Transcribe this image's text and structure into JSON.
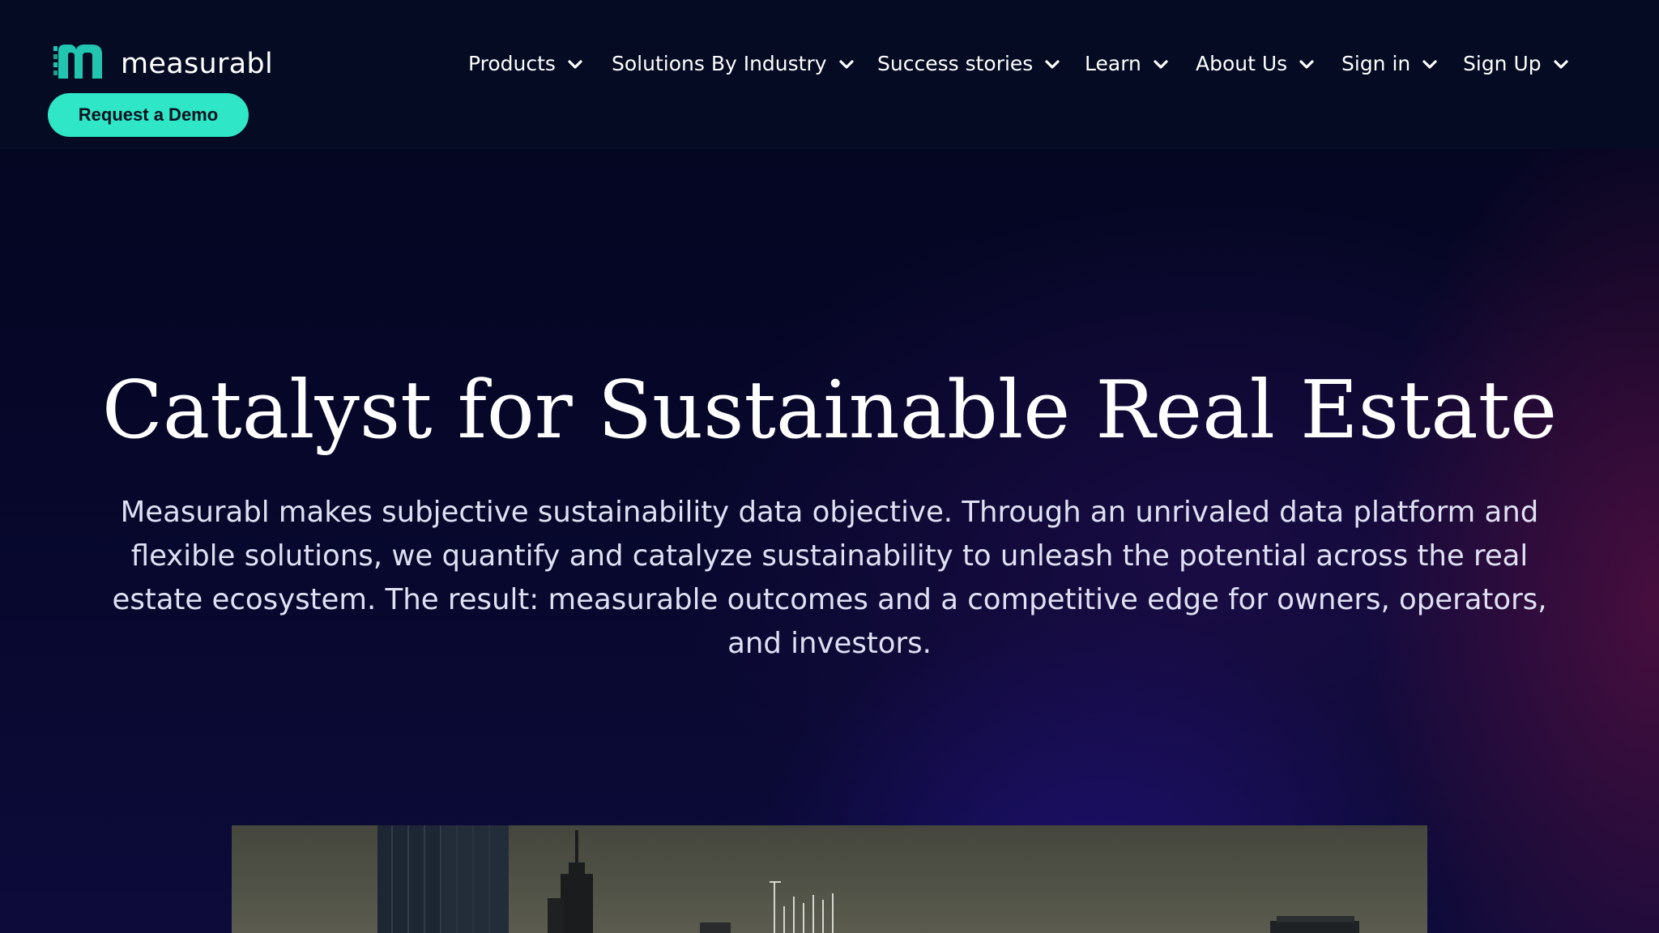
{
  "header": {
    "logo_text": "measurabl",
    "demo_button": "Request a Demo",
    "nav": [
      {
        "label": "Products"
      },
      {
        "label": "Solutions By Industry"
      },
      {
        "label": "Success stories"
      },
      {
        "label": "Learn"
      },
      {
        "label": "About Us"
      },
      {
        "label": "Sign in"
      },
      {
        "label": "Sign Up"
      }
    ]
  },
  "hero": {
    "title": "Catalyst for Sustainable Real Estate",
    "subtitle": "Measurabl makes subjective sustainability data objective. Through an unrivaled data platform and flexible solutions, we quantify and catalyze sustainability to unleash the potential across the real estate ecosystem. The result: measurable outcomes and a competitive edge for owners, operators, and investors."
  },
  "colors": {
    "header_bg": "#040b22",
    "accent": "#2fe6c6",
    "logo_mark": "#22c6b0"
  },
  "icons": {
    "logo": "measurabl-m-logo-icon",
    "nav_dropdown": "chevron-down-icon"
  }
}
